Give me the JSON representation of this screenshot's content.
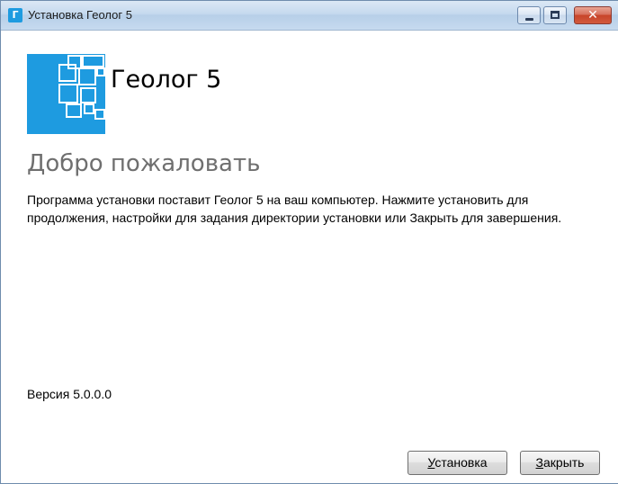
{
  "window": {
    "title": "Установка Геолог 5",
    "app_icon_glyph": "Г",
    "minimize_glyph_name": "minimize-icon",
    "maximize_glyph_name": "maximize-icon",
    "close_glyph": "✕"
  },
  "header": {
    "product_name": "Геолог 5",
    "logo_icon": "squares-logo-icon",
    "logo_color": "#1e9be0"
  },
  "content": {
    "welcome": "Добро пожаловать",
    "description": "Программа установки поставит Геолог 5 на ваш компьютер. Нажмите установить для продолжения, настройки для задания директории установки или Закрыть для завершения.",
    "version": "Версия 5.0.0.0"
  },
  "buttons": {
    "install_accel": "У",
    "install_rest": "становка",
    "close_accel": "З",
    "close_rest": "акрыть"
  }
}
